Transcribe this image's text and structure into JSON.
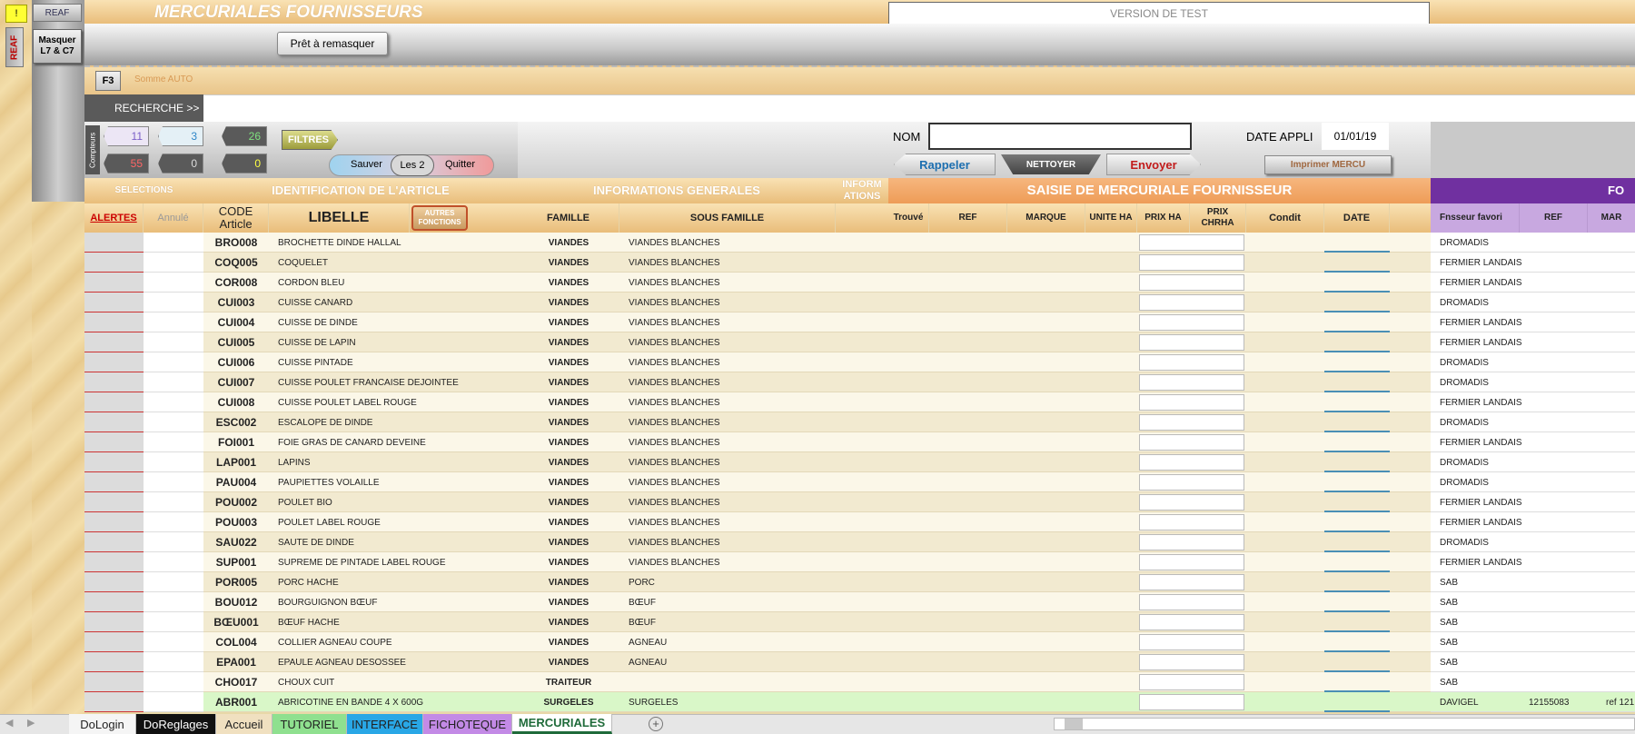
{
  "header": {
    "warn": "!",
    "reaf_btn": "REAF",
    "reaf_side": "REAF",
    "title": "MERCURIALES FOURNISSEURS",
    "version": "VERSION DE TEST",
    "masquer": "Masquer L7 & C7",
    "pret": "Prêt à remasquer",
    "f3": "F3",
    "somme": "Somme AUTO",
    "recherche": "RECHERCHE >>"
  },
  "counters": {
    "label": "Compteurs",
    "values": [
      "11",
      "3",
      "26",
      "55",
      "0",
      "0"
    ]
  },
  "buttons": {
    "filtres": "FILTRES",
    "sauver": "Sauver",
    "les2": "Les 2",
    "quitter": "Quitter",
    "nom_label": "NOM",
    "date_appli_label": "DATE APPLI",
    "date_appli_value": "01/01/19",
    "rappeler": "Rappeler",
    "nettoyer": "NETTOYER",
    "envoyer": "Envoyer",
    "imprimer": "Imprimer MERCU",
    "autres": "AUTRES FONCTIONS"
  },
  "sections": {
    "selections": "SELECTIONS",
    "identification": "IDENTIFICATION DE L'ARTICLE",
    "infos": "INFORMATIONS GENERALES",
    "inform": "INFORM ATIONS",
    "saisie": "SAISIE DE MERCURIALE FOURNISSEUR",
    "fo": "FO"
  },
  "columns": {
    "alertes": "ALERTES",
    "annule": "Annulé",
    "code": "CODE Article",
    "libelle": "LIBELLE",
    "famille": "FAMILLE",
    "sous_famille": "SOUS FAMILLE",
    "trouve": "Trouvé",
    "ref": "REF",
    "marque": "MARQUE",
    "unite": "UNITE HA",
    "prix_ha": "PRIX HA",
    "prix_chrha": "PRIX CHRHA",
    "condit": "Condit",
    "date": "DATE",
    "fnsseur": "Fnsseur favori",
    "ref2": "REF",
    "mar": "MAR"
  },
  "rows": [
    {
      "code": "BRO008",
      "libelle": "BROCHETTE DINDE HALLAL",
      "famille": "VIANDES",
      "sous": "VIANDES BLANCHES",
      "fnsseur": "DROMADIS"
    },
    {
      "code": "COQ005",
      "libelle": "COQUELET",
      "famille": "VIANDES",
      "sous": "VIANDES BLANCHES",
      "fnsseur": "FERMIER LANDAIS"
    },
    {
      "code": "COR008",
      "libelle": "CORDON BLEU",
      "famille": "VIANDES",
      "sous": "VIANDES BLANCHES",
      "fnsseur": "FERMIER LANDAIS"
    },
    {
      "code": "CUI003",
      "libelle": "CUISSE CANARD",
      "famille": "VIANDES",
      "sous": "VIANDES BLANCHES",
      "fnsseur": "DROMADIS"
    },
    {
      "code": "CUI004",
      "libelle": "CUISSE DE DINDE",
      "famille": "VIANDES",
      "sous": "VIANDES BLANCHES",
      "fnsseur": "FERMIER LANDAIS"
    },
    {
      "code": "CUI005",
      "libelle": "CUISSE DE LAPIN",
      "famille": "VIANDES",
      "sous": "VIANDES BLANCHES",
      "fnsseur": "FERMIER LANDAIS"
    },
    {
      "code": "CUI006",
      "libelle": "CUISSE PINTADE",
      "famille": "VIANDES",
      "sous": "VIANDES BLANCHES",
      "fnsseur": "DROMADIS"
    },
    {
      "code": "CUI007",
      "libelle": "CUISSE POULET FRANCAISE DEJOINTEE",
      "famille": "VIANDES",
      "sous": "VIANDES BLANCHES",
      "fnsseur": "DROMADIS"
    },
    {
      "code": "CUI008",
      "libelle": "CUISSE POULET LABEL ROUGE",
      "famille": "VIANDES",
      "sous": "VIANDES BLANCHES",
      "fnsseur": "FERMIER LANDAIS"
    },
    {
      "code": "ESC002",
      "libelle": "ESCALOPE DE DINDE",
      "famille": "VIANDES",
      "sous": "VIANDES BLANCHES",
      "fnsseur": "DROMADIS"
    },
    {
      "code": "FOI001",
      "libelle": "FOIE GRAS DE CANARD DEVEINE",
      "famille": "VIANDES",
      "sous": "VIANDES BLANCHES",
      "fnsseur": "FERMIER LANDAIS"
    },
    {
      "code": "LAP001",
      "libelle": "LAPINS",
      "famille": "VIANDES",
      "sous": "VIANDES BLANCHES",
      "fnsseur": "DROMADIS"
    },
    {
      "code": "PAU004",
      "libelle": "PAUPIETTES VOLAILLE",
      "famille": "VIANDES",
      "sous": "VIANDES BLANCHES",
      "fnsseur": "DROMADIS"
    },
    {
      "code": "POU002",
      "libelle": "POULET BIO",
      "famille": "VIANDES",
      "sous": "VIANDES BLANCHES",
      "fnsseur": "FERMIER LANDAIS"
    },
    {
      "code": "POU003",
      "libelle": "POULET LABEL ROUGE",
      "famille": "VIANDES",
      "sous": "VIANDES BLANCHES",
      "fnsseur": "FERMIER LANDAIS"
    },
    {
      "code": "SAU022",
      "libelle": "SAUTE DE DINDE",
      "famille": "VIANDES",
      "sous": "VIANDES BLANCHES",
      "fnsseur": "DROMADIS"
    },
    {
      "code": "SUP001",
      "libelle": "SUPREME DE PINTADE LABEL ROUGE",
      "famille": "VIANDES",
      "sous": "VIANDES BLANCHES",
      "fnsseur": "FERMIER LANDAIS"
    },
    {
      "code": "POR005",
      "libelle": "PORC HACHE",
      "famille": "VIANDES",
      "sous": "PORC",
      "fnsseur": "SAB"
    },
    {
      "code": "BOU012",
      "libelle": "BOURGUIGNON BŒUF",
      "famille": "VIANDES",
      "sous": "BŒUF",
      "fnsseur": "SAB"
    },
    {
      "code": "BŒU001",
      "libelle": "BŒUF HACHE",
      "famille": "VIANDES",
      "sous": "BŒUF",
      "fnsseur": "SAB"
    },
    {
      "code": "COL004",
      "libelle": "COLLIER AGNEAU COUPE",
      "famille": "VIANDES",
      "sous": "AGNEAU",
      "fnsseur": "SAB"
    },
    {
      "code": "EPA001",
      "libelle": "EPAULE AGNEAU DESOSSEE",
      "famille": "VIANDES",
      "sous": "AGNEAU",
      "fnsseur": "SAB"
    },
    {
      "code": "CHO017",
      "libelle": "CHOUX CUIT",
      "famille": "TRAITEUR",
      "sous": "",
      "fnsseur": "SAB"
    },
    {
      "code": "ABR001",
      "libelle": "ABRICOTINE EN BANDE 4 X 600G",
      "famille": "SURGELES",
      "sous": "SURGELES",
      "fnsseur": "DAVIGEL",
      "ref2": "12155083",
      "mar": "ref 121"
    }
  ],
  "tabs": [
    {
      "label": "DoLogin",
      "bg": "#f5f5f5",
      "fg": "#222"
    },
    {
      "label": "DoReglages",
      "bg": "#111111",
      "fg": "#ffffff"
    },
    {
      "label": "Accueil",
      "bg": "#f0e0c0",
      "fg": "#222"
    },
    {
      "label": "TUTORIEL",
      "bg": "#8fe08f",
      "fg": "#222"
    },
    {
      "label": "INTERFACE",
      "bg": "#29a7e6",
      "fg": "#222"
    },
    {
      "label": "FICHOTEQUE",
      "bg": "#c38ae6",
      "fg": "#222"
    },
    {
      "label": "MERCURIALES",
      "bg": "#ffffff",
      "fg": "#1f6b3a"
    }
  ],
  "colors": {
    "purple": "#7030a0",
    "green_row": "#d9f7c8"
  }
}
